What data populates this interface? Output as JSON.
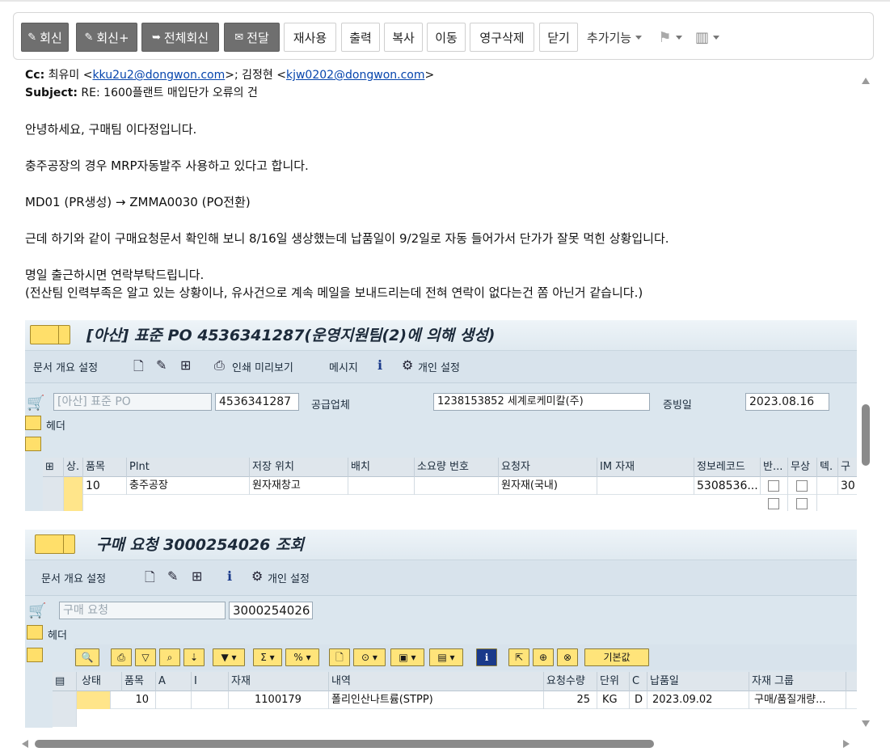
{
  "toolbar": {
    "reply": "회신",
    "reply_plus": "회신+",
    "reply_all": "전체회신",
    "forward": "전달",
    "reuse": "재사용",
    "print": "출력",
    "copy": "복사",
    "move": "이동",
    "delete_permanent": "영구삭제",
    "close": "닫기",
    "more": "추가기능"
  },
  "email": {
    "cc_label": "Cc:",
    "cc_name1": "최유미 <",
    "cc_email1": "kku2u2@dongwon.com",
    "cc_sep": ">; 김정현 <",
    "cc_email2": "kjw0202@dongwon.com",
    "cc_end": ">",
    "subject_label": "Subject:",
    "subject": "RE: 1600플랜트 매입단가 오류의 건",
    "body": [
      "안녕하세요, 구매팀 이다정입니다.",
      "충주공장의 경우 MRP자동발주 사용하고 있다고 합니다.",
      "MD01 (PR생성) → ZMMA0030 (PO전환)",
      "근데 하기와 같이 구매요청문서 확인해 보니 8/16일 생상했는데 납품일이 9/2일로 자동 들어가서 단가가 잘못 먹힌 상황입니다.",
      "명일 출근하시면 연락부탁드립니다.",
      "(전산팀 인력부족은 알고 있는 상황이나, 유사건으로 계속 메일을 보내드리는데 전혀 연락이 없다는건 쫌 아닌거 같습니다.)"
    ]
  },
  "po": {
    "title": "[아산] 표준 PO 4536341287(운영지원팀(2)에 의해 생성)",
    "menu": [
      "문서 개요 설정",
      "인쇄 미리보기",
      "메시지",
      "개인 설정"
    ],
    "doc_type": "[아산] 표준 PO",
    "doc_number": "4536341287",
    "vendor_label": "공급업체",
    "vendor": "1238153852 세계로케미칼(주)",
    "date_label": "증빙일",
    "date": "2023.08.16",
    "header_label": "헤더",
    "columns": [
      "상.",
      "품목",
      "Plnt",
      "저장 위치",
      "배치",
      "소요량 번호",
      "요청자",
      "IM 자재",
      "정보레코드",
      "반...",
      "무상",
      "텍.",
      "구"
    ],
    "rows": [
      {
        "item": "10",
        "plant": "충주공장",
        "storage": "원자재창고",
        "requester": "원자재(국내)",
        "info_record": "5308536...",
        "last": "30"
      }
    ]
  },
  "pr": {
    "title": "구매 요청 3000254026 조회",
    "menu": [
      "문서 개요 설정",
      "개인 설정"
    ],
    "doc_type": "구매 요청",
    "doc_number": "3000254026",
    "header_label": "헤더",
    "default_btn": "기본값",
    "columns": [
      "상태",
      "품목",
      "A",
      "I",
      "자재",
      "내역",
      "요청수량",
      "단위",
      "C",
      "납품일",
      "자재 그룹"
    ],
    "rows": [
      {
        "item": "10",
        "material": "1100179",
        "desc": "폴리인산나트륨(STPP)",
        "qty": "25",
        "unit": "KG",
        "c": "D",
        "delivery": "2023.09.02",
        "group": "구매/품질개량..."
      }
    ]
  }
}
